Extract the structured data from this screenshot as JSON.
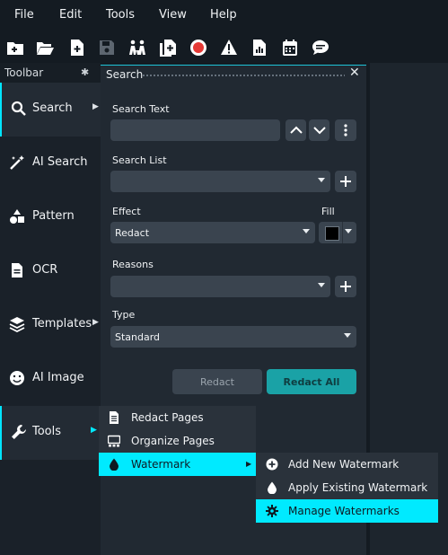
{
  "menubar": {
    "items": [
      "File",
      "Edit",
      "Tools",
      "View",
      "Help"
    ]
  },
  "toolbar": {
    "icons": [
      "new-file-icon",
      "open-folder-icon",
      "add-document-icon",
      "save-icon",
      "people-icon",
      "copy-add-icon",
      "record-icon",
      "warning-icon",
      "report-icon",
      "calendar-icon",
      "chat-icon"
    ],
    "record_color": "#e53935"
  },
  "left_panel": {
    "title": "Toolbar",
    "items": [
      {
        "label": "Search",
        "icon": "search-icon",
        "active": true
      },
      {
        "label": "AI Search",
        "icon": "magic-wand-icon"
      },
      {
        "label": "Pattern",
        "icon": "shapes-icon"
      },
      {
        "label": "OCR",
        "icon": "document-icon"
      },
      {
        "label": "Templates",
        "icon": "layers-icon"
      },
      {
        "label": "AI Image",
        "icon": "smiley-icon"
      },
      {
        "label": "Tools",
        "icon": "wrench-icon"
      }
    ]
  },
  "search_panel": {
    "title": "Search",
    "search_text_label": "Search Text",
    "search_text_value": "",
    "search_list_label": "Search List",
    "search_list_value": "",
    "effect_label": "Effect",
    "effect_value": "Redact",
    "fill_label": "Fill",
    "fill_color": "#000000",
    "reasons_label": "Reasons",
    "reasons_value": "",
    "type_label": "Type",
    "type_value": "Standard",
    "redact_label": "Redact",
    "redact_all_label": "Redact All"
  },
  "tools_menu": {
    "items": [
      {
        "label": "Redact Pages",
        "icon": "document-icon"
      },
      {
        "label": "Organize Pages",
        "icon": "grid-icon"
      },
      {
        "label": "Watermark",
        "icon": "droplet-icon",
        "highlighted": true
      }
    ]
  },
  "watermark_menu": {
    "items": [
      {
        "label": "Add New Watermark",
        "icon": "plus-circle-icon"
      },
      {
        "label": "Apply Existing Watermark",
        "icon": "droplet-icon"
      },
      {
        "label": "Manage Watermarks",
        "icon": "gear-icon",
        "highlighted": true
      }
    ]
  },
  "colors": {
    "accent": "#00eaff",
    "primary_button": "#1aa2a6"
  }
}
